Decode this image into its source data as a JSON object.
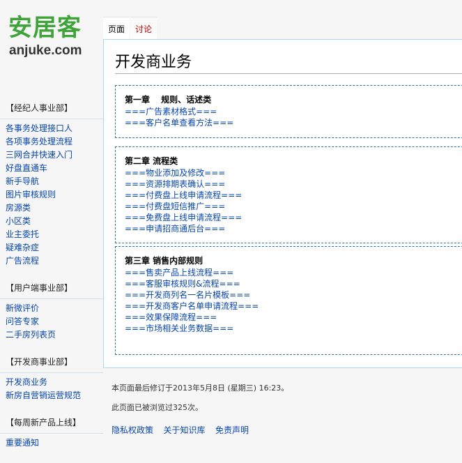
{
  "logo": {
    "cn": "安居客",
    "en": "anjuke.com"
  },
  "tabs": [
    {
      "label": "页面"
    },
    {
      "label": "讨论"
    }
  ],
  "sidebar": {
    "sections": [
      {
        "title": "【经纪人事业部】",
        "items": [
          "各事务处理接口人",
          "各项事务处理流程",
          "三网合并快速入门",
          "好盘直通车",
          "新手导航",
          "图片审核规则",
          "房源类",
          "小区类",
          "业主委托",
          "疑难杂症",
          "广告流程"
        ]
      },
      {
        "title": "【用户端事业部】",
        "items": [
          "新微评价",
          "问答专家",
          "二手房列表页"
        ]
      },
      {
        "title": "【开发商事业部】",
        "items": [
          "开发商业务",
          "新房自营销运营规范"
        ]
      },
      {
        "title": "【每周新产品上线】",
        "items": [
          "重要通知"
        ]
      }
    ]
  },
  "page": {
    "title": "开发商业务",
    "chapters": [
      {
        "heading": "第一章　 规则、话述类",
        "items": [
          "===广告素材格式===",
          "===客户名单查看方法==="
        ]
      },
      {
        "heading": "第二章  流程类",
        "items": [
          "===物业添加及修改===",
          "===资源排期表确认===",
          "===付费盘上线申请流程===",
          "===付费盘短信推广===",
          "===免费盘上线申请流程===",
          "===申请招商通后台==="
        ]
      },
      {
        "heading": "第三章  销售内部规则",
        "items": [
          "===售卖产品上线流程===",
          "===客服审核规则&流程===",
          "===开发商列名一名片模板===",
          "===开发商客户名单申请流程===",
          "===效果保障流程===",
          "===市场相关业务数据==="
        ]
      }
    ]
  },
  "footer": {
    "lastmod": "本页面最后修订于2013年5月8日 (星期三) 16:23。",
    "views": "此页面已被浏览过325次。",
    "links": [
      "隐私权政策",
      "关于知识库",
      "免责声明"
    ]
  }
}
